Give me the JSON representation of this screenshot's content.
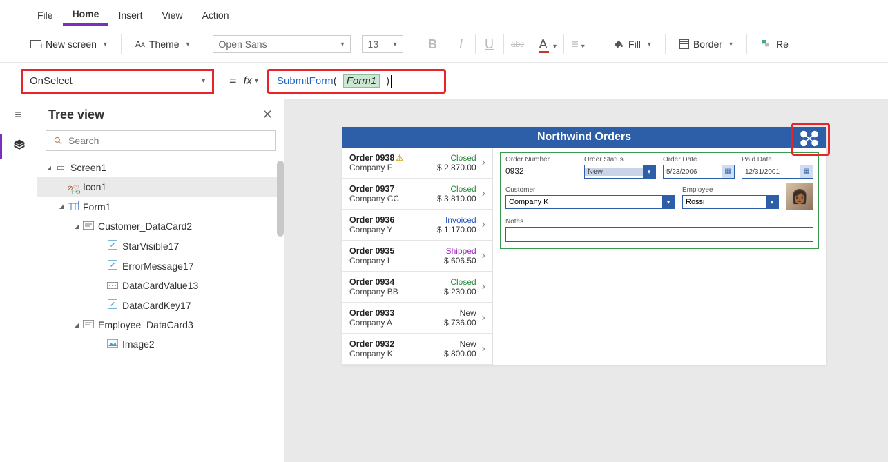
{
  "menu": {
    "items": [
      "File",
      "Home",
      "Insert",
      "View",
      "Action"
    ],
    "active": "Home"
  },
  "toolbar": {
    "newscreen": "New screen",
    "theme": "Theme",
    "font": "Open Sans",
    "fontsize": "13",
    "fill": "Fill",
    "border": "Border",
    "reorder": "Re"
  },
  "property": {
    "name": "OnSelect"
  },
  "formula": {
    "fn": "SubmitForm",
    "arg": "Form1"
  },
  "tree": {
    "title": "Tree view",
    "search_placeholder": "Search",
    "items": [
      {
        "level": 1,
        "icon": "screen",
        "label": "Screen1",
        "caret": true
      },
      {
        "level": 2,
        "icon": "icon",
        "label": "Icon1",
        "selected": true
      },
      {
        "level": 2,
        "icon": "form",
        "label": "Form1",
        "caret": true
      },
      {
        "level": 3,
        "icon": "card",
        "label": "Customer_DataCard2",
        "caret": true
      },
      {
        "level": 4,
        "icon": "ctrl",
        "label": "StarVisible17"
      },
      {
        "level": 4,
        "icon": "ctrl",
        "label": "ErrorMessage17"
      },
      {
        "level": 4,
        "icon": "input",
        "label": "DataCardValue13"
      },
      {
        "level": 4,
        "icon": "ctrl",
        "label": "DataCardKey17"
      },
      {
        "level": 3,
        "icon": "card",
        "label": "Employee_DataCard3",
        "caret": true
      },
      {
        "level": 4,
        "icon": "image",
        "label": "Image2"
      }
    ]
  },
  "app": {
    "title": "Northwind Orders",
    "orders": [
      {
        "num": "Order 0938",
        "warn": true,
        "company": "Company F",
        "status": "Closed",
        "status_class": "s-closed",
        "amount": "$ 2,870.00"
      },
      {
        "num": "Order 0937",
        "company": "Company CC",
        "status": "Closed",
        "status_class": "s-closed",
        "amount": "$ 3,810.00"
      },
      {
        "num": "Order 0936",
        "company": "Company Y",
        "status": "Invoiced",
        "status_class": "s-invoiced",
        "amount": "$ 1,170.00"
      },
      {
        "num": "Order 0935",
        "company": "Company I",
        "status": "Shipped",
        "status_class": "s-shipped",
        "amount": "$ 606.50"
      },
      {
        "num": "Order 0934",
        "company": "Company BB",
        "status": "Closed",
        "status_class": "s-closed",
        "amount": "$ 230.00"
      },
      {
        "num": "Order 0933",
        "company": "Company A",
        "status": "New",
        "status_class": "s-new",
        "amount": "$ 736.00"
      },
      {
        "num": "Order 0932",
        "company": "Company K",
        "status": "New",
        "status_class": "s-new",
        "amount": "$ 800.00"
      }
    ],
    "form": {
      "ordernum_label": "Order Number",
      "ordernum": "0932",
      "status_label": "Order Status",
      "status": "New",
      "orderdate_label": "Order Date",
      "orderdate": "5/23/2006",
      "paiddate_label": "Paid Date",
      "paiddate": "12/31/2001",
      "customer_label": "Customer",
      "customer": "Company K",
      "employee_label": "Employee",
      "employee": "Rossi",
      "notes_label": "Notes"
    }
  }
}
